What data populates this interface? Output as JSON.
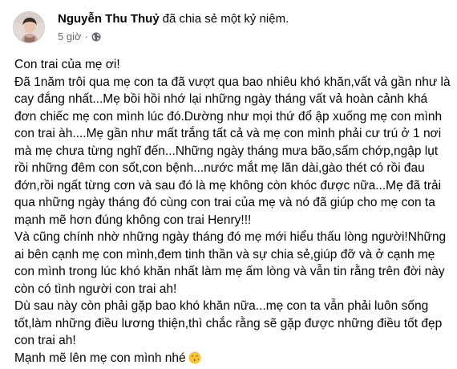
{
  "post": {
    "author": "Nguyễn Thu Thuỷ",
    "action": "đã chia sẻ một kỷ niệm.",
    "time": "5 giờ",
    "separator": "·",
    "privacy_icon": "globe-icon",
    "lines": [
      "Con trai của mẹ ơi!",
      "Đã 1năm trôi qua mẹ con ta đã vượt qua bao nhiêu khó khăn,vất vả gần như là cay đắng nhất...Mẹ bồi hồi nhớ lại những ngày tháng vất vả hoàn cảnh khá đơn chiếc mẹ con mình lúc đó.Dường như mọi thứ đổ ập xuống mẹ con mình con trai àh....Mẹ gần như mất trắng tất cả và mẹ con mình phải cư trú ở 1 nơi mà mẹ chưa từng nghĩ đến...Những ngày tháng mưa bão,sấm chớp,ngập lụt rồi những đêm con sốt,con bệnh...nước mắt mẹ lăn dài,gào thét có rồi đau đớn,rồi ngất từng cơn và sau đó là mẹ không còn khóc được nữa...Mẹ đã trải qua những ngày tháng đó cùng con trai của mẹ và nó đã giúp cho mẹ con ta mạnh mẽ hơn đúng không con trai Henry!!!",
      "Và cũng chính nhờ những ngày tháng đó mẹ mới hiểu thấu lòng người!Những ai bên cạnh mẹ con mình,đem tinh thần và sự chia sẻ,giúp đỡ và ở cạnh mẹ con mình trong lúc khó khăn nhất làm mẹ ấm lòng và vẫn tin rằng trên đời này còn có tình người con trai ah!",
      "Dù sau này còn phải gặp bao khó khăn nữa...mẹ con ta vẫn phải luôn sống tốt,làm những điều lương thiện,thì chắc rằng sẽ gặp được những điều tốt đẹp con trai ah!",
      "Mạnh mẽ lên mẹ con mình nhé"
    ],
    "closing_emoji_icon": "kiss-face-icon"
  }
}
